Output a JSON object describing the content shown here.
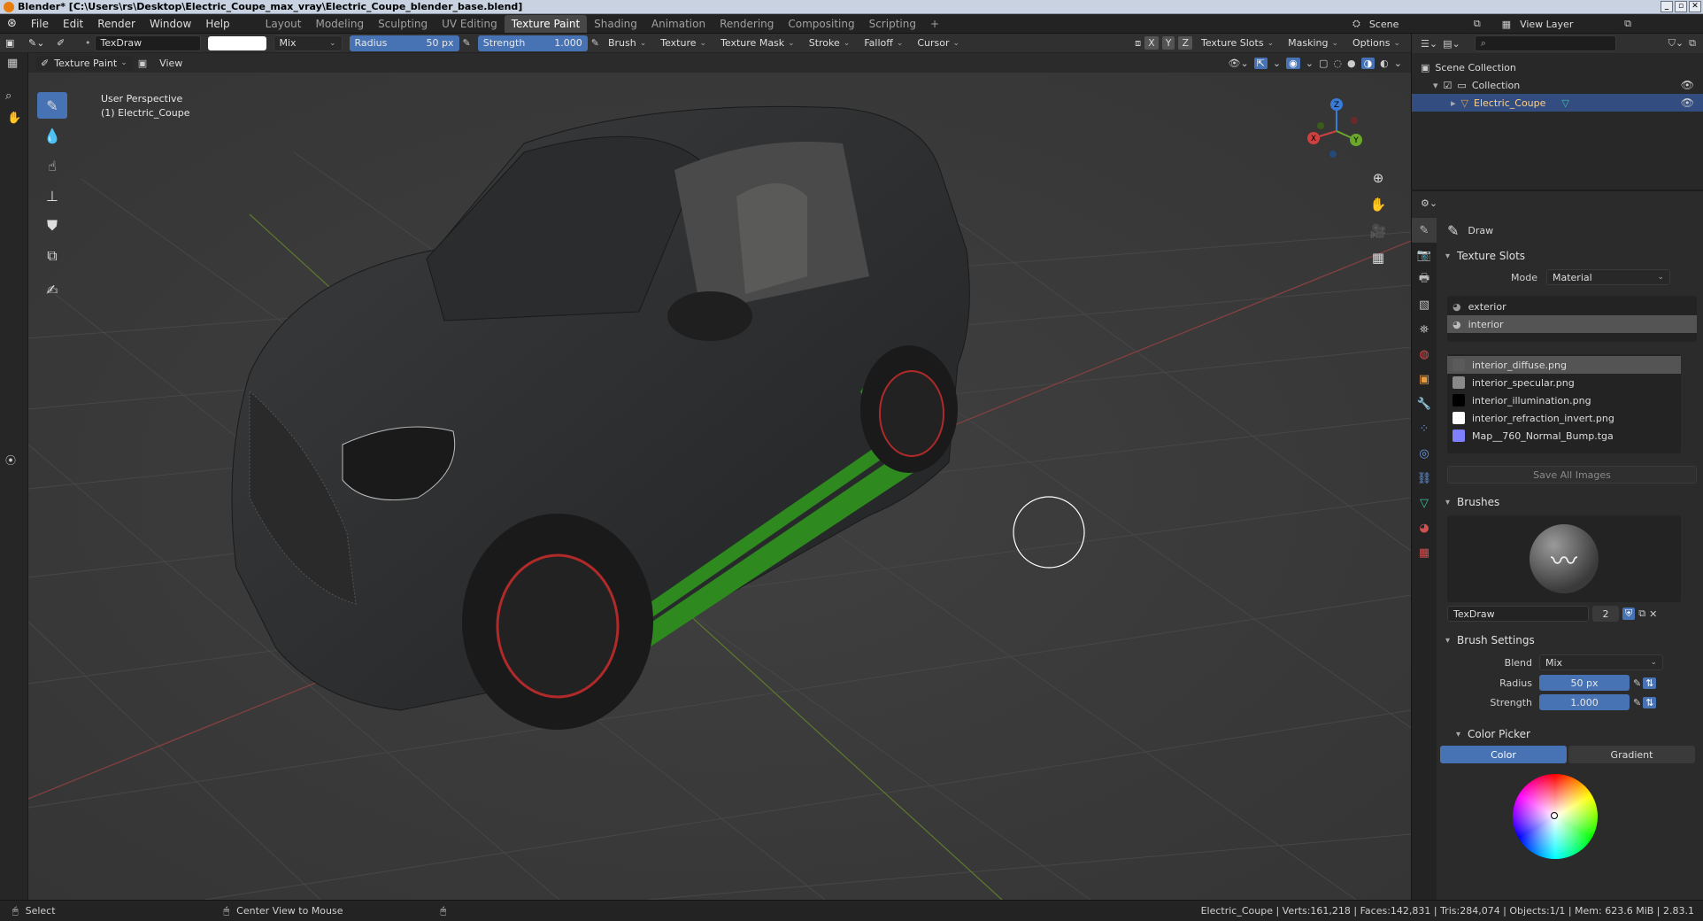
{
  "window": {
    "title": "Blender* [C:\\Users\\rs\\Desktop\\Electric_Coupe_max_vray\\Electric_Coupe_blender_base.blend]",
    "controls": [
      "_",
      "▫",
      "✕"
    ]
  },
  "menu": [
    "File",
    "Edit",
    "Render",
    "Window",
    "Help"
  ],
  "workspaces": [
    {
      "label": "Layout",
      "active": false
    },
    {
      "label": "Modeling",
      "active": false
    },
    {
      "label": "Sculpting",
      "active": false
    },
    {
      "label": "UV Editing",
      "active": false
    },
    {
      "label": "Texture Paint",
      "active": true
    },
    {
      "label": "Shading",
      "active": false
    },
    {
      "label": "Animation",
      "active": false
    },
    {
      "label": "Rendering",
      "active": false
    },
    {
      "label": "Compositing",
      "active": false
    },
    {
      "label": "Scripting",
      "active": false
    }
  ],
  "add_workspace": "+",
  "scene": {
    "label": "Scene",
    "view_layer": "View Layer"
  },
  "tool_header": {
    "brush_name": "TexDraw",
    "blend": "Mix",
    "radius_label": "Radius",
    "radius_value": "50 px",
    "strength_label": "Strength",
    "strength_value": "1.000",
    "menus": [
      "Brush",
      "Texture",
      "Texture Mask",
      "Stroke",
      "Falloff",
      "Cursor"
    ],
    "axes": [
      "X",
      "Y",
      "Z"
    ],
    "right_menus": [
      "Texture Slots",
      "Masking",
      "Options"
    ]
  },
  "viewport_header": {
    "mode": "Texture Paint",
    "view": "View"
  },
  "viewport": {
    "perspective": "User Perspective",
    "object": "(1) Electric_Coupe",
    "gizmo": {
      "x": "X",
      "y": "Y",
      "z": "Z"
    }
  },
  "outliner": {
    "root": "Scene Collection",
    "collection": "Collection",
    "object": "Electric_Coupe"
  },
  "properties": {
    "tool_name": "Draw",
    "texture_slots": {
      "title": "Texture Slots",
      "mode_label": "Mode",
      "mode_value": "Material",
      "materials": [
        {
          "label": "exterior",
          "selected": false
        },
        {
          "label": "interior",
          "selected": true
        }
      ],
      "images": [
        {
          "label": "interior_diffuse.png",
          "selected": true,
          "swatch": "#5a5a5a"
        },
        {
          "label": "interior_specular.png",
          "selected": false,
          "swatch": "#8a8a8a"
        },
        {
          "label": "interior_illumination.png",
          "selected": false,
          "swatch": "#000000"
        },
        {
          "label": "interior_refraction_invert.png",
          "selected": false,
          "swatch": "#ffffff"
        },
        {
          "label": "Map__760_Normal_Bump.tga",
          "selected": false,
          "swatch": "#8080ff"
        }
      ],
      "save_all": "Save All Images"
    },
    "brushes": {
      "title": "Brushes",
      "name": "TexDraw",
      "users": "2"
    },
    "brush_settings": {
      "title": "Brush Settings",
      "blend_label": "Blend",
      "blend_value": "Mix",
      "radius_label": "Radius",
      "radius_value": "50 px",
      "strength_label": "Strength",
      "strength_value": "1.000"
    },
    "color_picker": {
      "title": "Color Picker",
      "tab_color": "Color",
      "tab_gradient": "Gradient"
    }
  },
  "statusbar": {
    "select": "Select",
    "center": "Center View to Mouse",
    "stats": "Electric_Coupe | Verts:161,218 | Faces:142,831 | Tris:284,074 | Objects:1/1 | Mem: 623.6 MiB | 2.83.1"
  }
}
